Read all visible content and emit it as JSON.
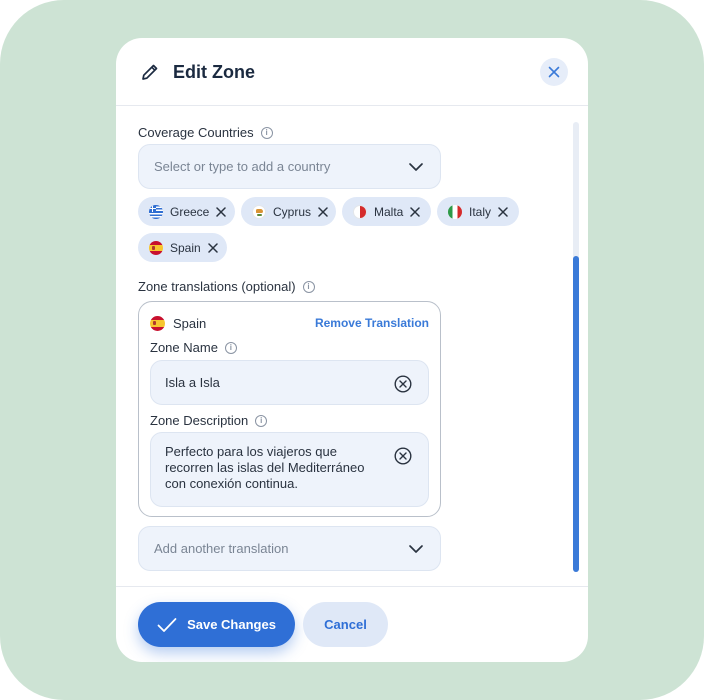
{
  "modal": {
    "title": "Edit Zone",
    "pencil_icon": "pencil-icon",
    "close_icon": "close-icon"
  },
  "coverage": {
    "label": "Coverage Countries",
    "select_placeholder": "Select or type to add a country",
    "chips": [
      {
        "name": "Greece"
      },
      {
        "name": "Cyprus"
      },
      {
        "name": "Malta"
      },
      {
        "name": "Italy"
      },
      {
        "name": "Spain"
      }
    ]
  },
  "translations": {
    "label": "Zone translations (optional)",
    "card": {
      "language": "Spain",
      "remove_label": "Remove Translation",
      "zone_name_label": "Zone Name",
      "zone_name_value": "Isla a Isla",
      "zone_description_label": "Zone Description",
      "zone_description_value": "Perfecto para los viajeros que recorren las islas del Mediterráneo con conexión continua."
    },
    "add_placeholder": "Add another translation"
  },
  "footer": {
    "save_label": "Save Changes",
    "cancel_label": "Cancel"
  },
  "colors": {
    "accent": "#2f6fd6",
    "background": "#cde3d4"
  }
}
